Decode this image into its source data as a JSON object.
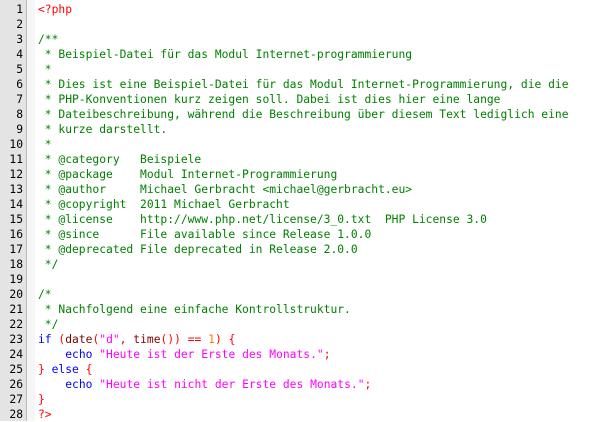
{
  "editor": {
    "language": "php",
    "colors": {
      "comment": "#008000",
      "php_tag": "#ff0000",
      "keyword": "#0000ff",
      "function": "#800000",
      "string": "#ff00ff",
      "number": "#ff8000",
      "operator": "#ff0000",
      "gutter_bg": "#e4e4e4"
    },
    "lines": [
      {
        "n": "1",
        "tokens": [
          {
            "t": "<?php",
            "c": "php"
          }
        ]
      },
      {
        "n": "2",
        "tokens": []
      },
      {
        "n": "3",
        "tokens": [
          {
            "t": "/**",
            "c": "comment"
          }
        ]
      },
      {
        "n": "4",
        "tokens": [
          {
            "t": " * Beispiel-Datei für das Modul Internet-programmierung",
            "c": "comment"
          }
        ]
      },
      {
        "n": "5",
        "tokens": [
          {
            "t": " *",
            "c": "comment"
          }
        ]
      },
      {
        "n": "6",
        "tokens": [
          {
            "t": " * Dies ist eine Beispiel-Datei für das Modul Internet-Programmierung, die die",
            "c": "comment"
          }
        ]
      },
      {
        "n": "7",
        "tokens": [
          {
            "t": " * PHP-Konventionen kurz zeigen soll. Dabei ist dies hier eine lange",
            "c": "comment"
          }
        ]
      },
      {
        "n": "8",
        "tokens": [
          {
            "t": " * Dateibeschreibung, während die Beschreibung über diesem Text lediglich eine",
            "c": "comment"
          }
        ]
      },
      {
        "n": "9",
        "tokens": [
          {
            "t": " * kurze darstellt.",
            "c": "comment"
          }
        ]
      },
      {
        "n": "10",
        "tokens": [
          {
            "t": " *",
            "c": "comment"
          }
        ]
      },
      {
        "n": "11",
        "tokens": [
          {
            "t": " * @category   Beispiele",
            "c": "comment"
          }
        ]
      },
      {
        "n": "12",
        "tokens": [
          {
            "t": " * @package    Modul Internet-Programmierung",
            "c": "comment"
          }
        ]
      },
      {
        "n": "13",
        "tokens": [
          {
            "t": " * @author     Michael Gerbracht <michael@gerbracht.eu>",
            "c": "comment"
          }
        ]
      },
      {
        "n": "14",
        "tokens": [
          {
            "t": " * @copyright  2011 Michael Gerbracht",
            "c": "comment"
          }
        ]
      },
      {
        "n": "15",
        "tokens": [
          {
            "t": " * @license    http://www.php.net/license/3_0.txt  PHP License 3.0",
            "c": "comment"
          }
        ]
      },
      {
        "n": "16",
        "tokens": [
          {
            "t": " * @since      File available since Release 1.0.0",
            "c": "comment"
          }
        ]
      },
      {
        "n": "17",
        "tokens": [
          {
            "t": " * @deprecated File deprecated in Release 2.0.0",
            "c": "comment"
          }
        ]
      },
      {
        "n": "18",
        "tokens": [
          {
            "t": " */",
            "c": "comment"
          }
        ]
      },
      {
        "n": "19",
        "tokens": []
      },
      {
        "n": "20",
        "tokens": [
          {
            "t": "/*",
            "c": "comment"
          }
        ]
      },
      {
        "n": "21",
        "tokens": [
          {
            "t": " * Nachfolgend eine einfache Kontrollstruktur.",
            "c": "comment"
          }
        ]
      },
      {
        "n": "22",
        "tokens": [
          {
            "t": " */",
            "c": "comment"
          }
        ]
      },
      {
        "n": "23",
        "tokens": [
          {
            "t": "if",
            "c": "kw"
          },
          {
            "t": " ",
            "c": "plain"
          },
          {
            "t": "(",
            "c": "op"
          },
          {
            "t": "date",
            "c": "fn"
          },
          {
            "t": "(",
            "c": "op"
          },
          {
            "t": "\"d\"",
            "c": "str"
          },
          {
            "t": ",",
            "c": "op"
          },
          {
            "t": " ",
            "c": "plain"
          },
          {
            "t": "time",
            "c": "fn"
          },
          {
            "t": "())",
            "c": "op"
          },
          {
            "t": " ",
            "c": "plain"
          },
          {
            "t": "==",
            "c": "op"
          },
          {
            "t": " ",
            "c": "plain"
          },
          {
            "t": "1",
            "c": "num"
          },
          {
            "t": ")",
            "c": "op"
          },
          {
            "t": " ",
            "c": "plain"
          },
          {
            "t": "{",
            "c": "op"
          }
        ]
      },
      {
        "n": "24",
        "tokens": [
          {
            "t": "    ",
            "c": "plain"
          },
          {
            "t": "echo",
            "c": "kw"
          },
          {
            "t": " ",
            "c": "plain"
          },
          {
            "t": "\"Heute ist der Erste des Monats.\"",
            "c": "str"
          },
          {
            "t": ";",
            "c": "op"
          }
        ]
      },
      {
        "n": "25",
        "tokens": [
          {
            "t": "}",
            "c": "op"
          },
          {
            "t": " ",
            "c": "plain"
          },
          {
            "t": "else",
            "c": "kw"
          },
          {
            "t": " ",
            "c": "plain"
          },
          {
            "t": "{",
            "c": "op"
          }
        ]
      },
      {
        "n": "26",
        "tokens": [
          {
            "t": "    ",
            "c": "plain"
          },
          {
            "t": "echo",
            "c": "kw"
          },
          {
            "t": " ",
            "c": "plain"
          },
          {
            "t": "\"Heute ist nicht der Erste des Monats.\"",
            "c": "str"
          },
          {
            "t": ";",
            "c": "op"
          }
        ]
      },
      {
        "n": "27",
        "tokens": [
          {
            "t": "}",
            "c": "op"
          }
        ]
      },
      {
        "n": "28",
        "tokens": [
          {
            "t": "?>",
            "c": "php"
          }
        ]
      }
    ]
  }
}
